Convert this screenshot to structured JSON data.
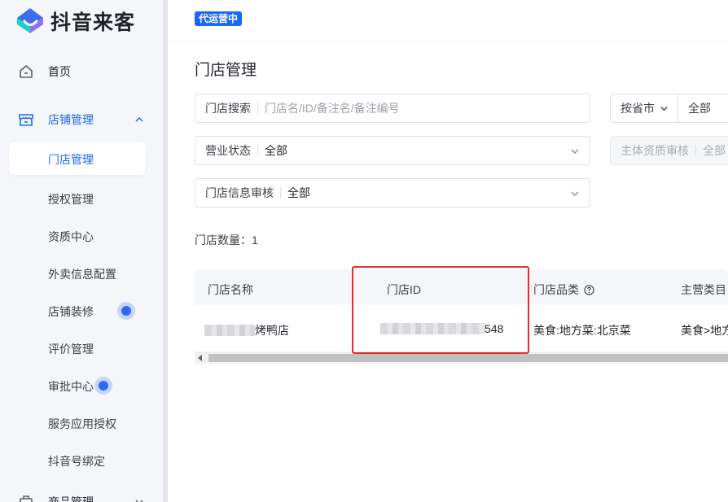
{
  "logo": {
    "text": "抖音来客"
  },
  "sidebar": {
    "home": "首页",
    "store_group": "店铺管理",
    "store_items": [
      "门店管理",
      "授权管理",
      "资质中心",
      "外卖信息配置",
      "店铺装修",
      "评价管理",
      "审批中心",
      "服务应用授权",
      "抖音号绑定"
    ],
    "goods_group": "商品管理"
  },
  "topbar": {
    "badge": "代运营中"
  },
  "page": {
    "title": "门店管理"
  },
  "filters": {
    "search_label": "门店搜索",
    "search_placeholder": "门店名/ID/备注名/备注编号",
    "province_select": "按省市",
    "province_value": "全部",
    "status_label": "营业状态",
    "status_value": "全部",
    "qual_label": "主体资质审核",
    "qual_value": "全部",
    "info_label": "门店信息审核",
    "info_value": "全部"
  },
  "count": {
    "text": "门店数量：1"
  },
  "table": {
    "headers": [
      "门店名称",
      "门店ID",
      "门店品类",
      "主营类目"
    ],
    "rows": [
      {
        "name_suffix": "烤鸭店",
        "id_suffix": "548",
        "category": "美食:地方菜:北京菜",
        "main_category": "美食>地方"
      }
    ]
  },
  "colors": {
    "accent": "#1966ff",
    "highlight": "#e52b2b"
  }
}
